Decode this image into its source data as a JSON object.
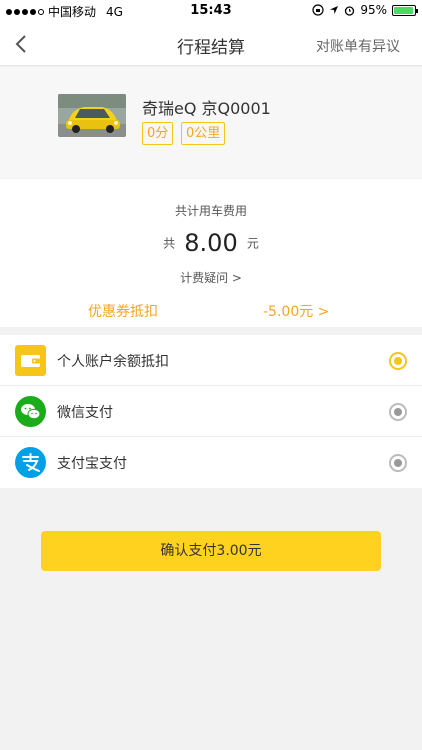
{
  "status_bar": {
    "carrier": "中国移动",
    "network": "4G",
    "time": "15:43",
    "battery": "95%",
    "battery_level": 0.95,
    "battery_color": "#4cd964"
  },
  "nav": {
    "title": "行程结算",
    "action": "对账单有异议"
  },
  "car": {
    "name": "奇瑞eQ 京Q0001",
    "tags": [
      "0分",
      "0公里"
    ]
  },
  "fee": {
    "label": "共计用车费用",
    "prefix": "共",
    "amount": "8.00",
    "unit": "元",
    "query": "计费疑问 >",
    "coupon_label": "优惠券抵扣",
    "coupon_value": "-5.00元 >"
  },
  "payment_methods": [
    {
      "label": "个人账户余额抵扣",
      "icon": "wallet-icon",
      "selected": true
    },
    {
      "label": "微信支付",
      "icon": "wechat-icon",
      "selected": false
    },
    {
      "label": "支付宝支付",
      "icon": "alipay-icon",
      "selected": false
    }
  ],
  "confirm_button": "确认支付3.00元",
  "colors": {
    "accent": "#ffd21f",
    "orange_text": "#f5a623",
    "wechat": "#1aad19",
    "alipay": "#00a0e9"
  }
}
